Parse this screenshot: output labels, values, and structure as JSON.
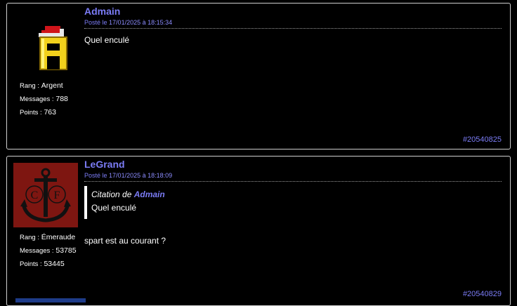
{
  "posts": [
    {
      "author": "Admain",
      "date_prefix": "Posté le",
      "date": "17/01/2025 à 18:15:34",
      "message": "Quel enculé",
      "rank_label": "Rang :",
      "rank": "Argent",
      "messages_label": "Messages :",
      "messages": "788",
      "points_label": "Points :",
      "points": "763",
      "id": "#20540825",
      "avatar": "pixel-letter-a-santa-hat"
    },
    {
      "author": "LeGrand",
      "date_prefix": "Posté le",
      "date": "17/01/2025 à 18:18:09",
      "quote_prefix": "Citation de",
      "quote_author": "Admain",
      "quote_text": "Quel enculé",
      "message": "spart est au courant ?",
      "rank_label": "Rang :",
      "rank": "Émeraude",
      "messages_label": "Messages :",
      "messages": "53785",
      "points_label": "Points :",
      "points": "53445",
      "id": "#20540829",
      "avatar": "anchor-cf-emblem"
    }
  ],
  "colors": {
    "accent": "#7b7cf5",
    "background": "#000000",
    "border": "#cfcfcf"
  }
}
